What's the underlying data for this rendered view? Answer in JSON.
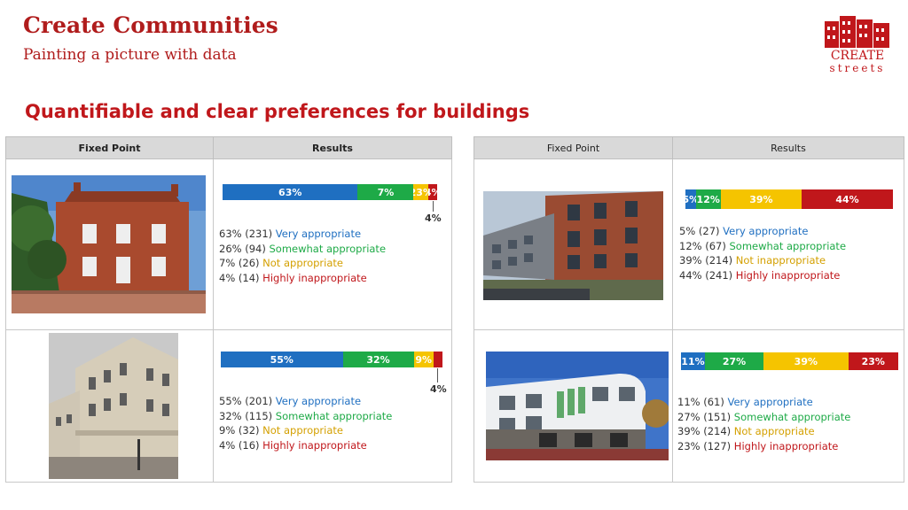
{
  "header": {
    "title": "Create Communities",
    "subtitle": "Painting a picture with data",
    "heading": "Quantifiable and clear preferences for buildings"
  },
  "logo": {
    "line1": "CREATE",
    "line2": "streets"
  },
  "tables": [
    {
      "col1": "Fixed Point",
      "col2": "Results"
    },
    {
      "col1": "Fixed Point",
      "col2": "Results"
    }
  ],
  "rows": [
    {
      "bar_labels": [
        "63%",
        "7%",
        "23%",
        "4%"
      ],
      "callout": "4%",
      "legend": [
        {
          "num": "63% (231)",
          "label": "Very appropriate"
        },
        {
          "num": "26% (94)",
          "label": "Somewhat appropriate"
        },
        {
          "num": "7% (26)",
          "label": "Not appropriate"
        },
        {
          "num": "4% (14)",
          "label": "Highly inappropriate"
        }
      ]
    },
    {
      "bar_labels": [
        "55%",
        "32%",
        "9%",
        ""
      ],
      "callout": "4%",
      "legend": [
        {
          "num": "55% (201)",
          "label": "Very appropriate"
        },
        {
          "num": "32% (115)",
          "label": "Somewhat appropriate"
        },
        {
          "num": "9% (32)",
          "label": "Not appropriate"
        },
        {
          "num": "4% (16)",
          "label": "Highly inappropriate"
        }
      ]
    },
    {
      "bar_labels": [
        "5%",
        "12%",
        "39%",
        "44%"
      ],
      "legend": [
        {
          "num": "5% (27)",
          "label": "Very appropriate"
        },
        {
          "num": "12% (67)",
          "label": "Somewhat appropriate"
        },
        {
          "num": "39% (214)",
          "label": "Not inappropriate"
        },
        {
          "num": "44% (241)",
          "label": "Highly inappropriate"
        }
      ]
    },
    {
      "bar_labels": [
        "11%",
        "27%",
        "39%",
        "23%"
      ],
      "legend": [
        {
          "num": "11% (61)",
          "label": "Very appropriate"
        },
        {
          "num": "27% (151)",
          "label": "Somewhat appropriate"
        },
        {
          "num": "39% (214)",
          "label": "Not appropriate"
        },
        {
          "num": "23% (127)",
          "label": "Highly inappropriate"
        }
      ]
    }
  ],
  "colors": {
    "brand_red": "#c0171b",
    "very_appropriate": "#1f6fc1",
    "somewhat_appropriate": "#1eaa47",
    "not_appropriate": "#f5c400",
    "highly_inappropriate": "#c0171b"
  }
}
